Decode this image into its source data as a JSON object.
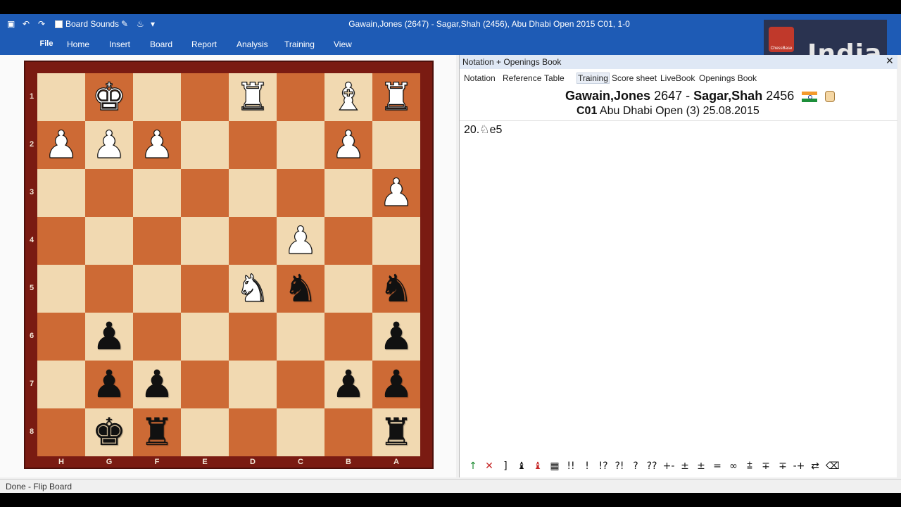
{
  "window": {
    "title": "Gawain,Jones (2647) - Sagar,Shah (2456), Abu Dhabi Open 2015  C01, 1-0",
    "qat_board_sounds": "Board Sounds"
  },
  "menu": {
    "file": "File",
    "items": [
      "Home",
      "Insert",
      "Board",
      "Report",
      "Analysis",
      "Training",
      "View"
    ]
  },
  "logo": {
    "chessbase": "ChessBase",
    "india": "India"
  },
  "board": {
    "ranks": [
      "1",
      "2",
      "3",
      "4",
      "5",
      "6",
      "7",
      "8"
    ],
    "files": [
      "H",
      "G",
      "F",
      "E",
      "D",
      "C",
      "B",
      "A"
    ],
    "pieces": [
      {
        "sq": "b1",
        "glyph": "♚",
        "color": "w"
      },
      {
        "sq": "e1",
        "glyph": "♜",
        "color": "w"
      },
      {
        "sq": "g1",
        "glyph": "♝",
        "color": "w"
      },
      {
        "sq": "h1",
        "glyph": "♜",
        "color": "w"
      },
      {
        "sq": "a2",
        "glyph": "♟",
        "color": "w"
      },
      {
        "sq": "b2",
        "glyph": "♟",
        "color": "w"
      },
      {
        "sq": "c2",
        "glyph": "♟",
        "color": "w"
      },
      {
        "sq": "g2",
        "glyph": "♟",
        "color": "w"
      },
      {
        "sq": "i3",
        "glyph": "♟",
        "color": "w"
      },
      {
        "sq": "f4",
        "glyph": "♟",
        "color": "w"
      },
      {
        "sq": "e5",
        "glyph": "♞",
        "color": "w"
      },
      {
        "sq": "f5",
        "glyph": "♞",
        "color": "b"
      },
      {
        "sq": "i5",
        "glyph": "♞",
        "color": "b"
      },
      {
        "sq": "b6",
        "glyph": "♟",
        "color": "b"
      },
      {
        "sq": "h6",
        "glyph": "♟",
        "color": "b"
      },
      {
        "sq": "b7",
        "glyph": "♟",
        "color": "b"
      },
      {
        "sq": "c7",
        "glyph": "♟",
        "color": "b"
      },
      {
        "sq": "g7",
        "glyph": "♟",
        "color": "b"
      },
      {
        "sq": "i7",
        "glyph": "♟",
        "color": "b"
      },
      {
        "sq": "b8",
        "glyph": "♚",
        "color": "b"
      },
      {
        "sq": "c8",
        "glyph": "♜",
        "color": "b"
      },
      {
        "sq": "i8",
        "glyph": "♜",
        "color": "b"
      }
    ]
  },
  "notation": {
    "panel_title": "Notation + Openings Book",
    "tabs": [
      "Notation",
      "Reference",
      "Table",
      "Training",
      "Score sheet",
      "LiveBook",
      "Openings Book"
    ],
    "active_tab": "Training",
    "white": "Gawain,Jones",
    "white_elo": "2647",
    "sep": "-",
    "black": "Sagar,Shah",
    "black_elo": "2456",
    "eco": "C01",
    "event": "Abu Dhabi Open (3) 25.08.2015",
    "moves": "20.♘e5"
  },
  "annotation_symbols": [
    "↑",
    "✕",
    "]",
    "♝",
    "♝",
    "▦",
    "!!",
    "!",
    "!?",
    "?!",
    "?",
    "??",
    "+-",
    "±",
    "±",
    "=",
    "∞",
    "⩲",
    "∓",
    "∓",
    "-+",
    "⇄",
    "⌫"
  ],
  "status": {
    "text": "Done - Flip Board"
  }
}
